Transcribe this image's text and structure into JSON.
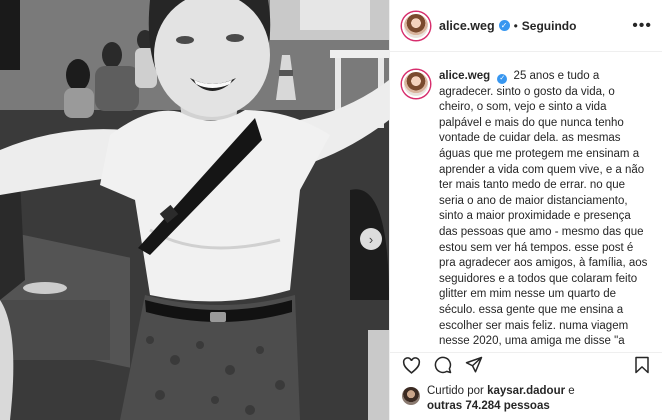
{
  "post": {
    "username": "alice.weg",
    "follow_status": "Seguindo",
    "more_icon": "more-horizontal-icon"
  },
  "caption": {
    "username": "alice.weg",
    "text": "25 anos e tudo a agradecer. sinto o gosto da vida, o cheiro, o som, vejo e sinto a vida palpável e mais do que nunca tenho vontade de cuidar dela. as mesmas águas que me protegem me ensinam a aprender a vida com quem vive, e a não ter mais tanto medo de errar. no que seria o ano de maior distanciamento, sinto a maior proximidade e presença das pessoas que amo - mesmo das que estou sem ver há tempos. esse post é pra agradecer aos amigos, à família, aos seguidores e a todos que colaram feito glitter em mim nesse um quarto de século. essa gente que me ensina a escolher ser mais feliz. numa viagem nesse 2020, uma amiga me disse \"a"
  },
  "likes": {
    "prefix": "Curtido por ",
    "user": "kaysar.dadour",
    "mid": " e",
    "count_text": "outras 74.284 pessoas"
  },
  "icons": [
    "heart-icon",
    "comment-icon",
    "share-icon",
    "bookmark-icon",
    "verified-icon",
    "chevron-right-icon"
  ]
}
